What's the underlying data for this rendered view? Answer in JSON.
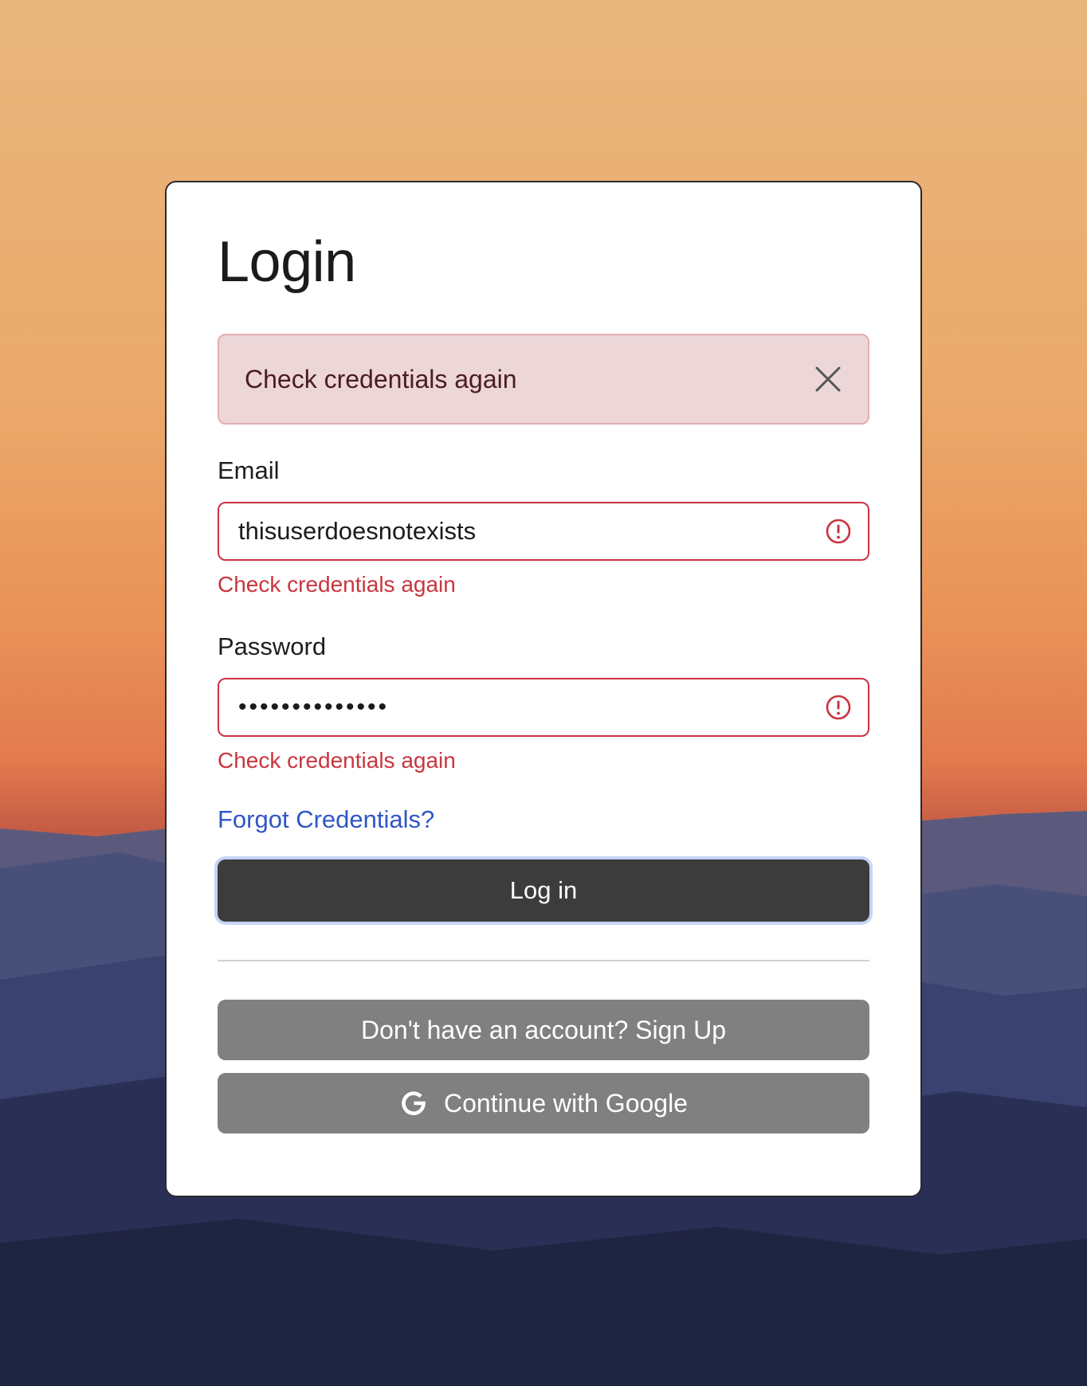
{
  "login": {
    "title": "Login",
    "alert": {
      "message": "Check credentials again",
      "close_icon": "close-icon"
    },
    "email": {
      "label": "Email",
      "value": "thisuserdoesnotexists",
      "error": "Check credentials again",
      "status_icon": "error-circle-icon"
    },
    "password": {
      "label": "Password",
      "value": "••••••••••••••",
      "error": "Check credentials again",
      "status_icon": "error-circle-icon"
    },
    "forgot_link": "Forgot Credentials?",
    "login_button": "Log in",
    "signup_button": "Don't have an account? Sign Up",
    "google_button": "Continue with Google",
    "google_icon": "google-icon"
  },
  "colors": {
    "error": "#c9353f",
    "alert_background": "#ecd6d8",
    "link": "#2f56c8",
    "primary_button": "#3c3c3c",
    "secondary_button": "#808080",
    "focus_ring": "#c7d3f6"
  }
}
